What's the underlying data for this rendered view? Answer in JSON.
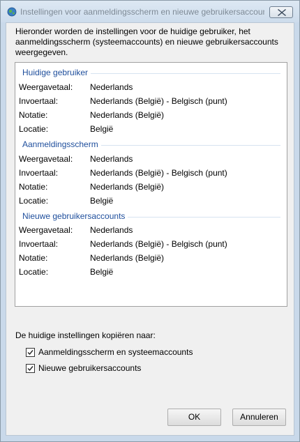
{
  "window": {
    "title": "Instellingen voor aanmeldingsscherm en nieuwe gebruikersaccoun..."
  },
  "intro": "Hieronder worden de instellingen voor de huidige gebruiker, het aanmeldingsscherm (systeemaccounts) en nieuwe gebruikersaccounts weergegeven.",
  "groups": [
    {
      "title": "Huidige gebruiker",
      "rows": [
        {
          "label": "Weergavetaal:",
          "value": "Nederlands"
        },
        {
          "label": "Invoertaal:",
          "value": "Nederlands (België) - Belgisch (punt)"
        },
        {
          "label": "Notatie:",
          "value": "Nederlands (België)"
        },
        {
          "label": "Locatie:",
          "value": "België"
        }
      ]
    },
    {
      "title": "Aanmeldingsscherm",
      "rows": [
        {
          "label": "Weergavetaal:",
          "value": "Nederlands"
        },
        {
          "label": "Invoertaal:",
          "value": "Nederlands (België) - Belgisch (punt)"
        },
        {
          "label": "Notatie:",
          "value": "Nederlands (België)"
        },
        {
          "label": "Locatie:",
          "value": "België"
        }
      ]
    },
    {
      "title": "Nieuwe gebruikersaccounts",
      "rows": [
        {
          "label": "Weergavetaal:",
          "value": "Nederlands"
        },
        {
          "label": "Invoertaal:",
          "value": "Nederlands (België) - Belgisch (punt)"
        },
        {
          "label": "Notatie:",
          "value": "Nederlands (België)"
        },
        {
          "label": "Locatie:",
          "value": "België"
        }
      ]
    }
  ],
  "copy": {
    "label": "De huidige instellingen kopiëren naar:",
    "options": [
      {
        "label": "Aanmeldingsscherm en systeemaccounts",
        "checked": true
      },
      {
        "label": "Nieuwe gebruikersaccounts",
        "checked": true
      }
    ]
  },
  "buttons": {
    "ok": "OK",
    "cancel": "Annuleren"
  },
  "icons": {
    "app": "globe-icon",
    "close": "close-icon",
    "check": "checkmark-icon"
  }
}
